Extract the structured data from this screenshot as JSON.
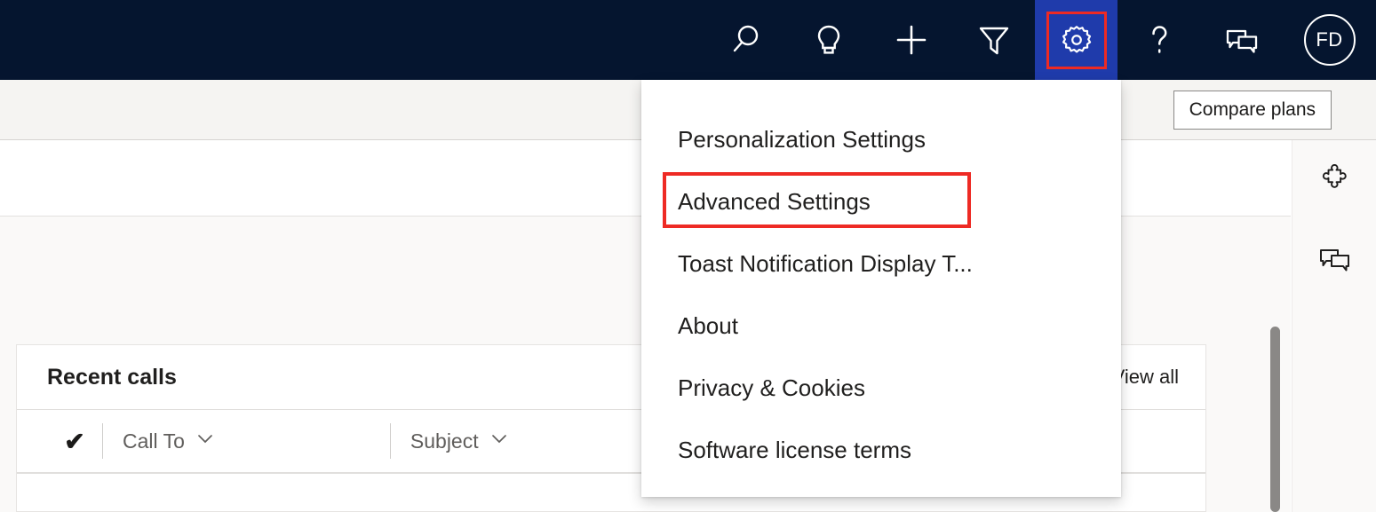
{
  "navbar": {
    "background": "#05152f",
    "active_background": "#1f3bab",
    "highlight_color": "#ee2a24",
    "icons": [
      {
        "name": "search-icon",
        "label": "Search"
      },
      {
        "name": "lightbulb-icon",
        "label": "Assistant"
      },
      {
        "name": "plus-icon",
        "label": "Quick create"
      },
      {
        "name": "filter-icon",
        "label": "Filter"
      },
      {
        "name": "gear-icon",
        "label": "Settings"
      },
      {
        "name": "question-mark-icon",
        "label": "Help"
      },
      {
        "name": "chat-icon",
        "label": "Feedback"
      }
    ],
    "avatar_initials": "FD"
  },
  "command_bar": {
    "compare_plans_label": "Compare plans"
  },
  "menu": {
    "items": [
      {
        "label": "Personalization Settings",
        "highlighted": false
      },
      {
        "label": "Advanced Settings",
        "highlighted": true
      },
      {
        "label": "Toast Notification Display T...",
        "highlighted": false
      },
      {
        "label": "About",
        "highlighted": false
      },
      {
        "label": "Privacy & Cookies",
        "highlighted": false
      },
      {
        "label": "Software license terms",
        "highlighted": false
      }
    ]
  },
  "recent_calls": {
    "title": "Recent calls",
    "view_all_label": "View all",
    "columns": [
      {
        "label": "Call To"
      },
      {
        "label": "Subject"
      }
    ],
    "check_glyph": "✔"
  },
  "right_rail": {
    "icons": [
      {
        "name": "puzzle-piece-icon",
        "label": "Add-ins"
      },
      {
        "name": "chat-icon",
        "label": "Conversation"
      }
    ]
  },
  "scrollbar": {
    "thumb_color": "#8a8886"
  }
}
